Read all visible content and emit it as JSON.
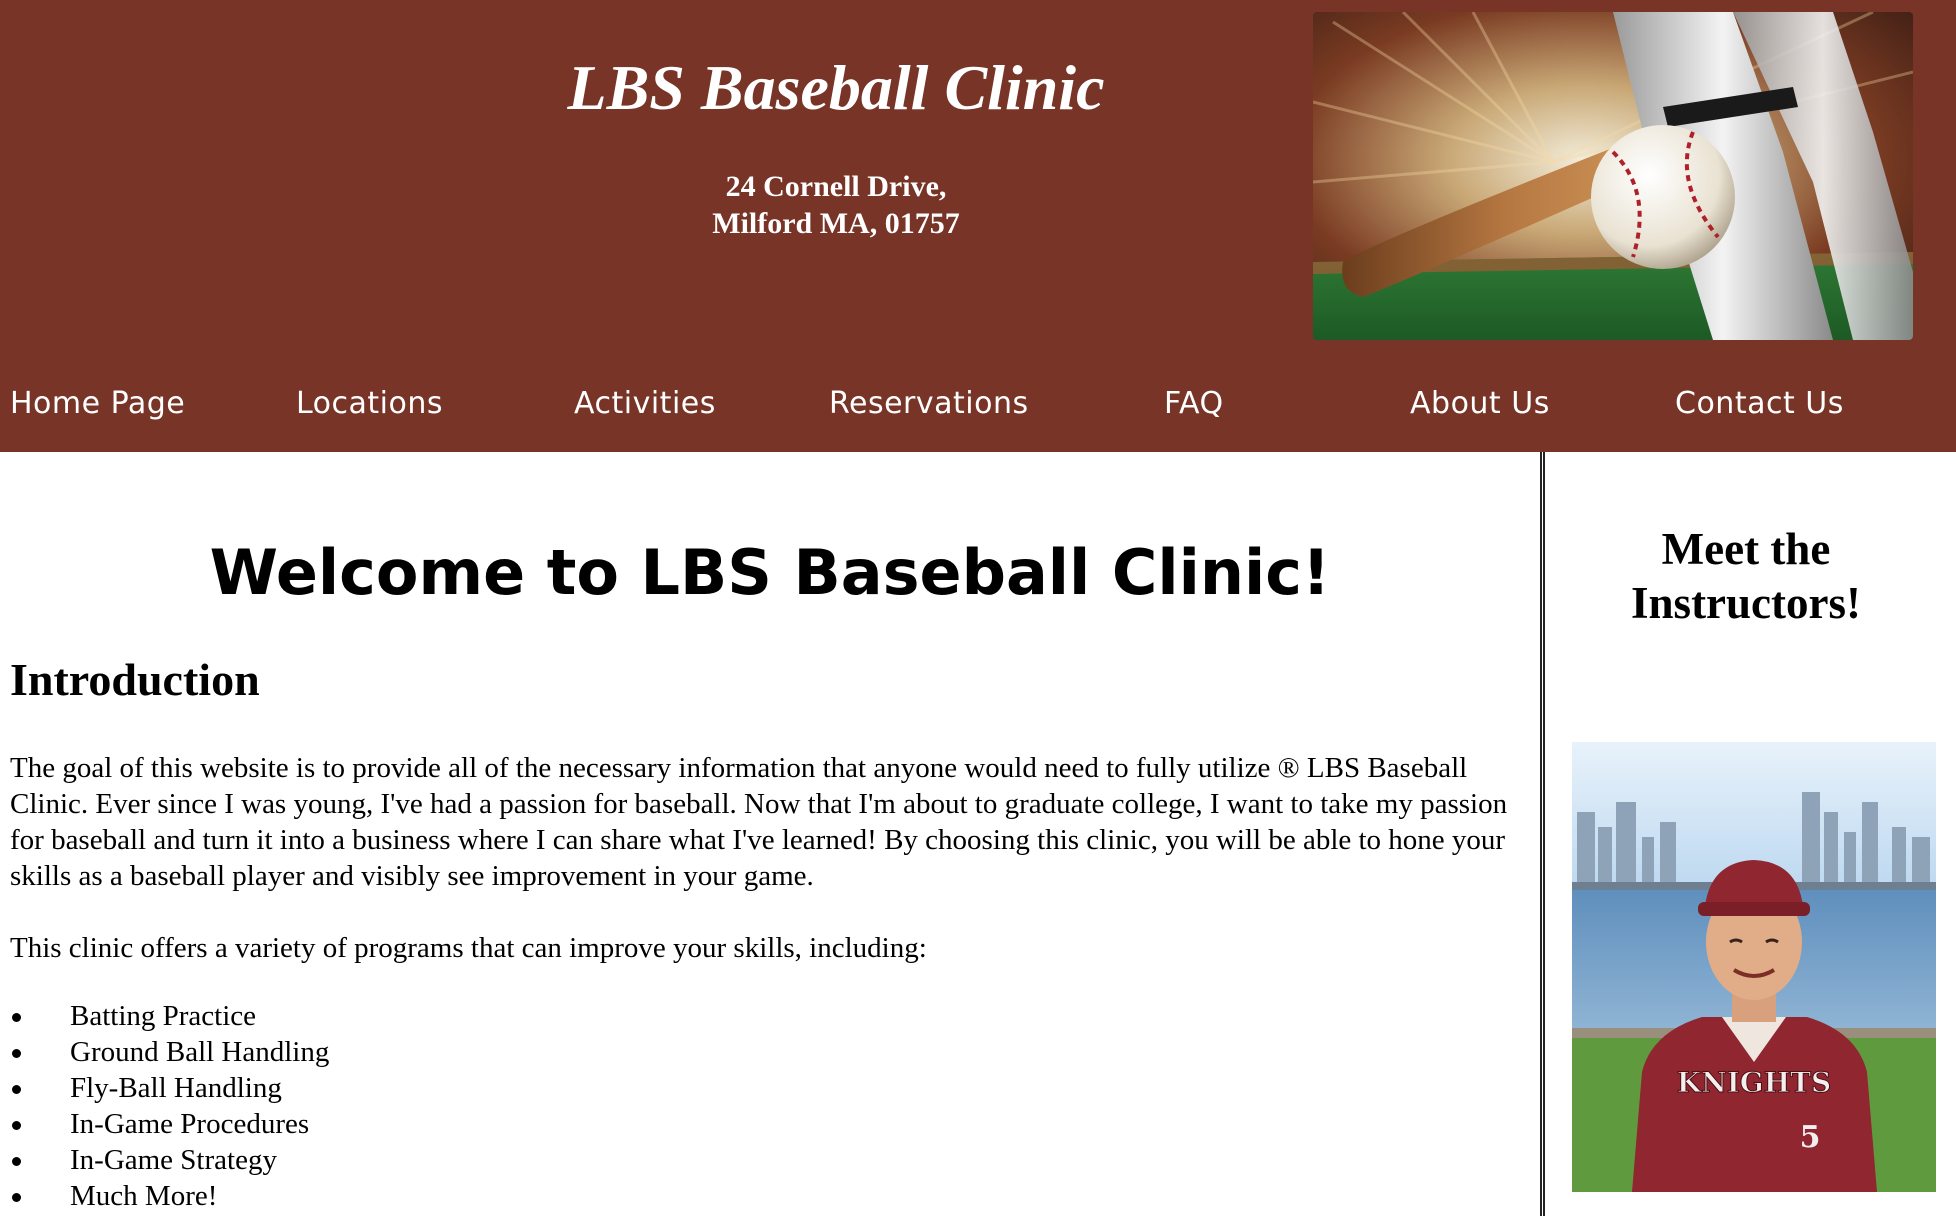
{
  "header": {
    "title": "LBS Baseball Clinic",
    "address_line1": "24 Cornell Drive,",
    "address_line2": "Milford MA, 01757",
    "hero_image": "baseball-bat-hitting-ball"
  },
  "nav": {
    "items": [
      {
        "label": "Home Page"
      },
      {
        "label": "Locations"
      },
      {
        "label": "Activities"
      },
      {
        "label": "Reservations"
      },
      {
        "label": "FAQ"
      },
      {
        "label": "About Us"
      },
      {
        "label": "Contact Us"
      }
    ]
  },
  "main": {
    "welcome": "Welcome to LBS Baseball Clinic!",
    "intro_heading": "Introduction",
    "paragraph1": "The goal of this website is to provide all of the necessary information that anyone would need to fully utilize ® LBS Baseball Clinic. Ever since I was young, I've had a passion for baseball. Now that I'm about to graduate college, I want to take my passion for baseball and turn it into a business where I can share what I've learned! By choosing this clinic, you will be able to hone your skills as a baseball player and visibly see improvement in your game.",
    "paragraph2": "This clinic offers a variety of programs that can improve your skills, including:",
    "programs": [
      "Batting Practice",
      "Ground Ball Handling",
      "Fly-Ball Handling",
      "In-Game Procedures",
      "In-Game Strategy",
      "Much More!"
    ]
  },
  "sidebar": {
    "heading_line1": "Meet the",
    "heading_line2": "Instructors!",
    "instructor_image": "instructor-photo",
    "jersey_text": "KNIGHTS",
    "jersey_number": "5"
  },
  "colors": {
    "header_bg": "#773427",
    "jersey": "#8f2630"
  }
}
